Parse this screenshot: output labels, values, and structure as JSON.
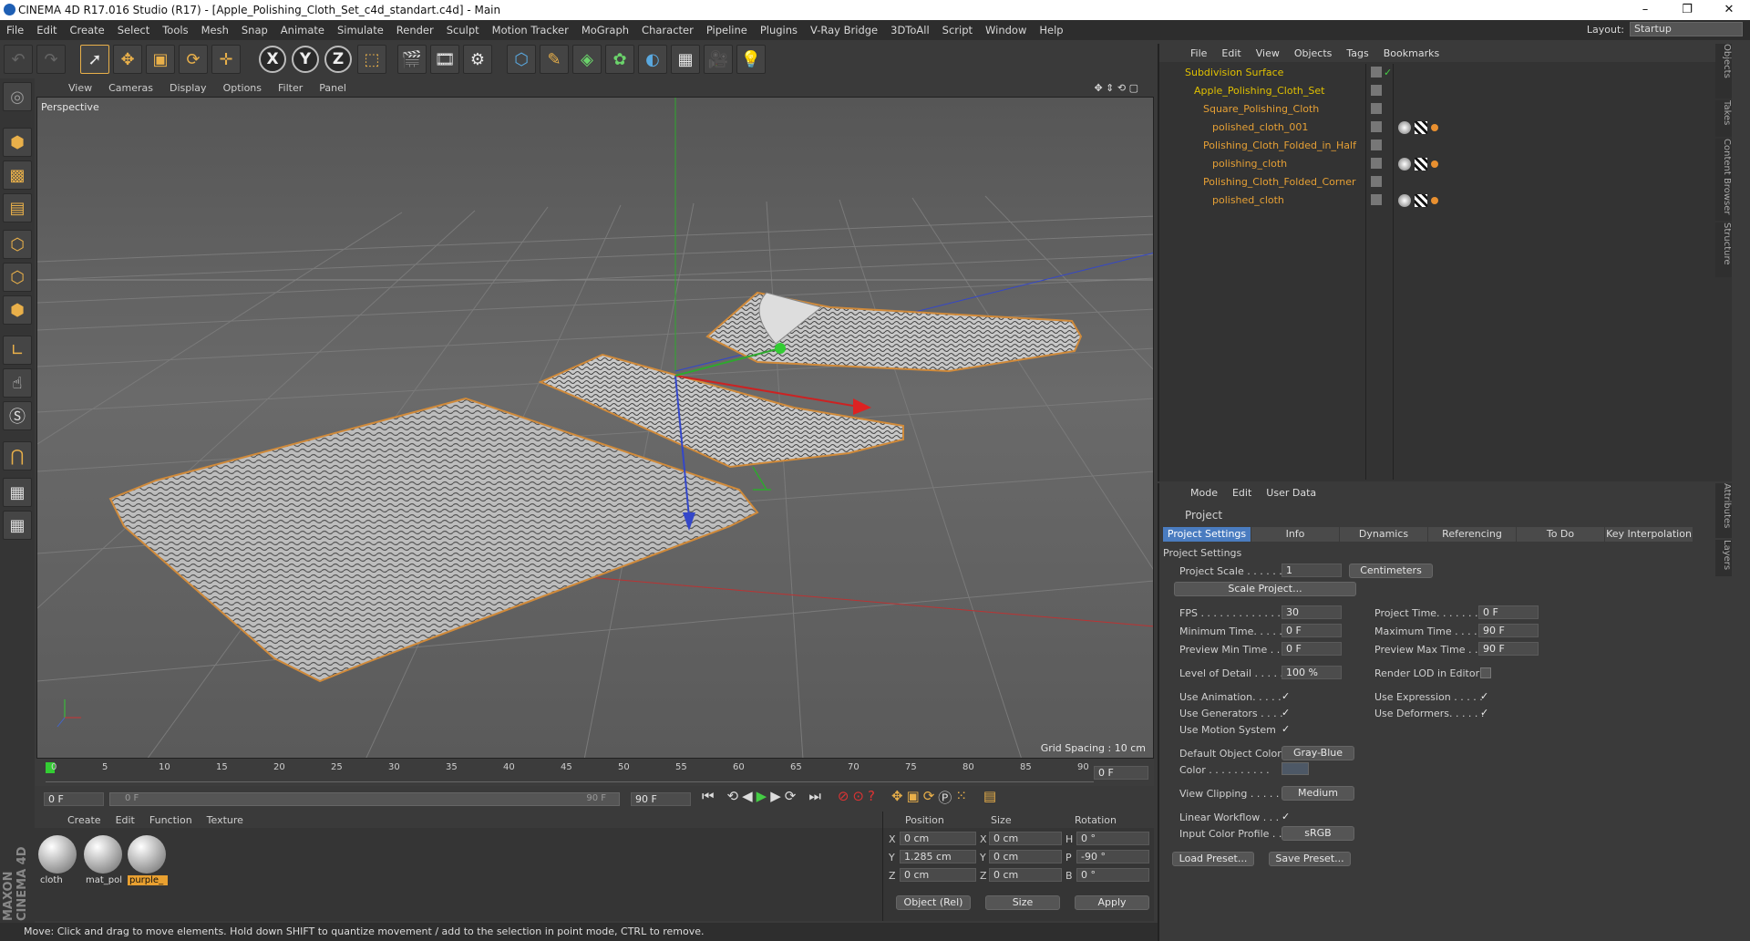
{
  "window": {
    "title": "CINEMA 4D R17.016 Studio (R17) - [Apple_Polishing_Cloth_Set_c4d_standart.c4d] - Main",
    "minimize": "–",
    "maximize": "❐",
    "close": "✕"
  },
  "menu": [
    "File",
    "Edit",
    "Create",
    "Select",
    "Tools",
    "Mesh",
    "Snap",
    "Animate",
    "Simulate",
    "Render",
    "Sculpt",
    "Motion Tracker",
    "MoGraph",
    "Character",
    "Pipeline",
    "Plugins",
    "V-Ray Bridge",
    "3DToAll",
    "Script",
    "Window",
    "Help"
  ],
  "layout": {
    "label": "Layout:",
    "value": "Startup"
  },
  "toolbar": {
    "x": "X",
    "y": "Y",
    "z": "Z"
  },
  "viewport": {
    "menu": [
      "View",
      "Cameras",
      "Display",
      "Options",
      "Filter",
      "Panel"
    ],
    "label": "Perspective",
    "grid_spacing": "Grid Spacing : 10 cm"
  },
  "timeline": {
    "ticks": [
      "0",
      "5",
      "10",
      "15",
      "20",
      "25",
      "30",
      "35",
      "40",
      "45",
      "50",
      "55",
      "60",
      "65",
      "70",
      "75",
      "80",
      "85",
      "90"
    ],
    "end_field": "0 F",
    "start": "0 F",
    "slider_left": "0 F",
    "slider_right": "90 F",
    "end": "90 F"
  },
  "materials": {
    "menu": [
      "Create",
      "Edit",
      "Function",
      "Texture"
    ],
    "items": [
      {
        "name": "cloth"
      },
      {
        "name": "mat_pol"
      },
      {
        "name": "purple_"
      }
    ],
    "brand": "MAXON CINEMA 4D"
  },
  "coords": {
    "headers": [
      "Position",
      "Size",
      "Rotation"
    ],
    "rows": [
      {
        "axis": "X",
        "pos": "0 cm",
        "saxis": "X",
        "size": "0 cm",
        "raxis": "H",
        "rot": "0 °"
      },
      {
        "axis": "Y",
        "pos": "1.285 cm",
        "saxis": "Y",
        "size": "0 cm",
        "raxis": "P",
        "rot": "-90 °"
      },
      {
        "axis": "Z",
        "pos": "0 cm",
        "saxis": "Z",
        "size": "0 cm",
        "raxis": "B",
        "rot": "0 °"
      }
    ],
    "mode": "Object (Rel)",
    "size_mode": "Size",
    "apply": "Apply"
  },
  "status": "Move: Click and drag to move elements. Hold down SHIFT to quantize movement / add to the selection in point mode, CTRL to remove.",
  "objects": {
    "menu": [
      "File",
      "Edit",
      "View",
      "Objects",
      "Tags",
      "Bookmarks"
    ],
    "tree": [
      {
        "name": "Subdivision Surface",
        "level": 0,
        "top": true
      },
      {
        "name": "Apple_Polishing_Cloth_Set",
        "level": 1,
        "top": true
      },
      {
        "name": "Square_Polishing_Cloth",
        "level": 2
      },
      {
        "name": "polished_cloth_001",
        "level": 3,
        "tags": true
      },
      {
        "name": "Polishing_Cloth_Folded_in_Half",
        "level": 2
      },
      {
        "name": "polishing_cloth",
        "level": 3,
        "tags": true
      },
      {
        "name": "Polishing_Cloth_Folded_Corner",
        "level": 2
      },
      {
        "name": "polished_cloth",
        "level": 3,
        "tags": true
      }
    ],
    "side_tabs": [
      "Objects",
      "Takes",
      "Content Browser",
      "Structure"
    ]
  },
  "attributes": {
    "menu": [
      "Mode",
      "Edit",
      "User Data"
    ],
    "title": "Project",
    "tabs": [
      "Project Settings",
      "Info",
      "Dynamics",
      "Referencing",
      "To Do",
      "Key Interpolation"
    ],
    "section": "Project Settings",
    "project_scale_label": "Project Scale . . . . . .",
    "project_scale_value": "1",
    "project_scale_unit": "Centimeters",
    "scale_project_btn": "Scale Project...",
    "fps_label": "FPS . . . . . . . . . . . . . .",
    "fps": "30",
    "project_time_label": "Project Time. . . . . . . .",
    "project_time": "0 F",
    "min_time_label": "Minimum Time. . . . .",
    "min_time": "0 F",
    "max_time_label": "Maximum Time . . . . .",
    "max_time": "90 F",
    "prev_min_label": "Preview Min Time . .",
    "prev_min": "0 F",
    "prev_max_label": "Preview Max Time . . .",
    "prev_max": "90 F",
    "lod_label": "Level of Detail . . . . .",
    "lod": "100 %",
    "render_lod_label": "Render LOD in Editor",
    "use_anim_label": "Use Animation. . . . .",
    "use_expr_label": "Use Expression . . . . .",
    "use_gen_label": "Use Generators . . . .",
    "use_def_label": "Use Deformers. . . . . .",
    "use_motion_label": "Use Motion System",
    "def_color_label": "Default Object Color",
    "def_color": "Gray-Blue",
    "color_label": "Color . . . . . . . . . .",
    "view_clip_label": "View Clipping . . . . .",
    "view_clip": "Medium",
    "linear_label": "Linear Workflow . . .",
    "input_profile_label": "Input Color Profile . .",
    "input_profile": "sRGB",
    "load_preset": "Load Preset...",
    "save_preset": "Save Preset...",
    "side_tabs": [
      "Attributes",
      "Layers"
    ]
  }
}
